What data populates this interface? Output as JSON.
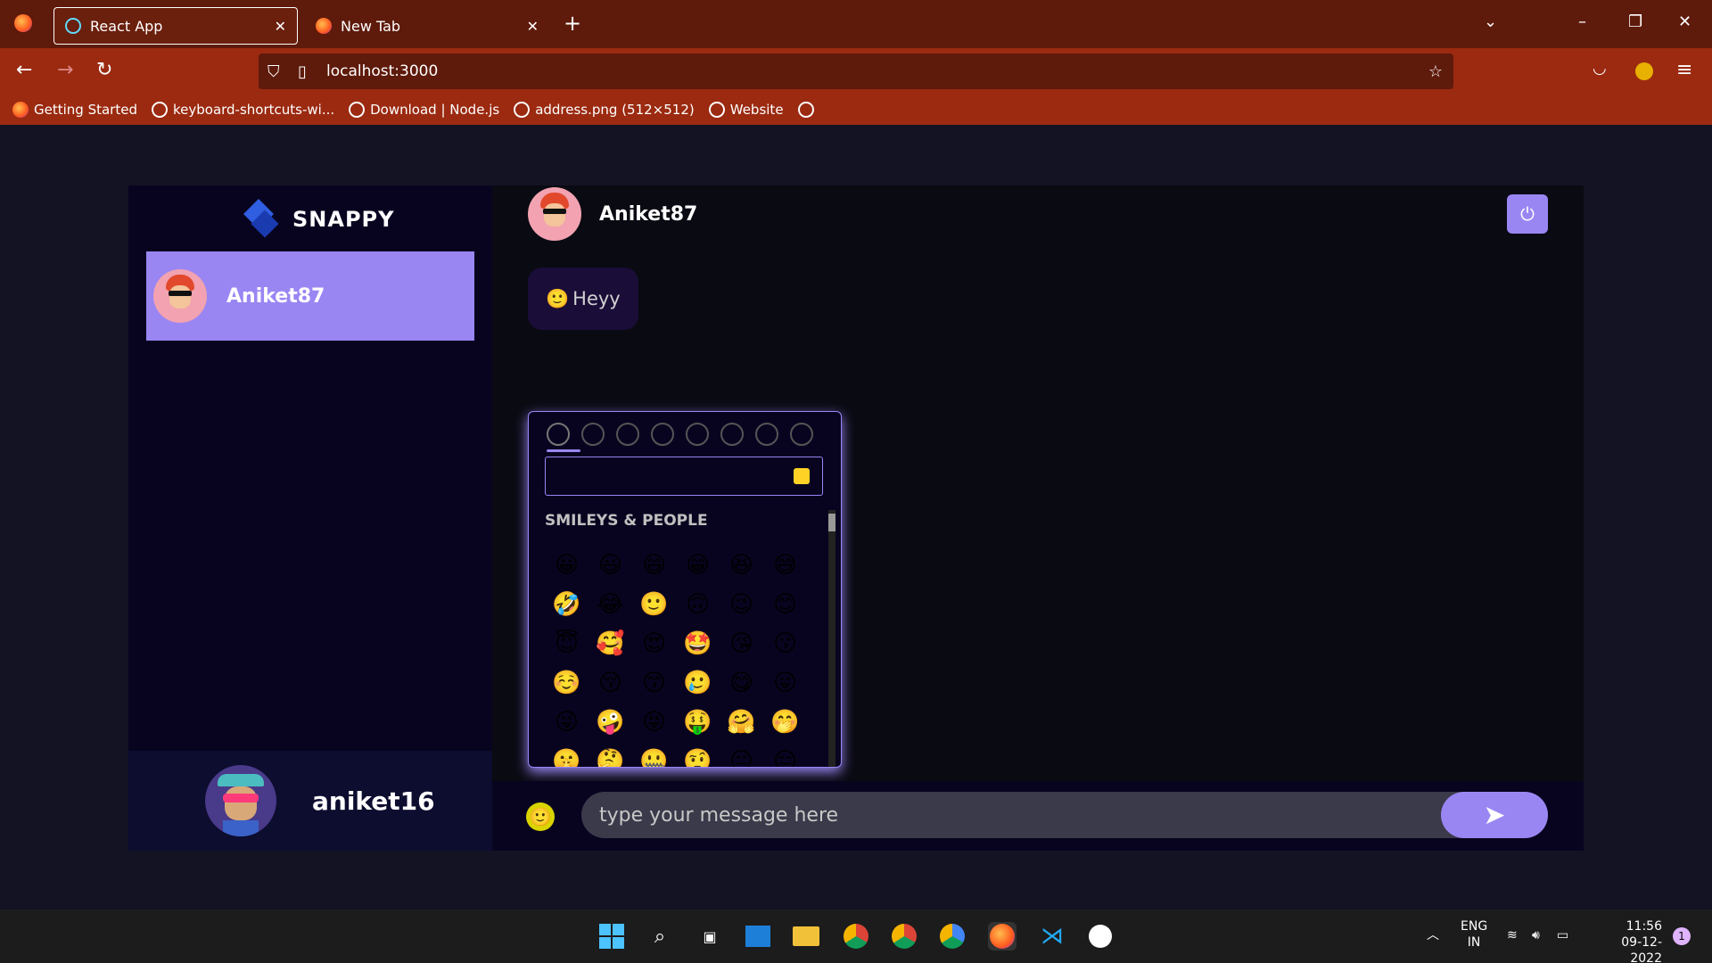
{
  "browser": {
    "tabs": [
      {
        "label": "React App",
        "active": true
      },
      {
        "label": "New Tab",
        "active": false
      }
    ],
    "url": "localhost:3000",
    "bookmarks": [
      {
        "label": "Getting Started",
        "icon": "firefox-icon"
      },
      {
        "label": "keyboard-shortcuts-wi...",
        "icon": "globe-icon"
      },
      {
        "label": "Download | Node.js",
        "icon": "globe-icon"
      },
      {
        "label": "address.png (512×512)",
        "icon": "globe-icon"
      },
      {
        "label": "Website",
        "icon": "globe-icon"
      }
    ]
  },
  "app": {
    "brand": "SNAPPY",
    "contacts": [
      {
        "name": "Aniket87",
        "selected": true
      }
    ],
    "current_user": "aniket16",
    "chat": {
      "user": "Aniket87",
      "messages": [
        {
          "emoji": "🙂",
          "text": "Heyy"
        }
      ]
    },
    "picker": {
      "section": "SMILEYS & PEOPLE",
      "emojis": [
        "😀",
        "😃",
        "😄",
        "😁",
        "😆",
        "😅",
        "🤣",
        "😂",
        "🙂",
        "🙃",
        "😉",
        "😊",
        "😇",
        "🥰",
        "😍",
        "🤩",
        "😘",
        "😗",
        "☺️",
        "😚",
        "😙",
        "🥲",
        "😋",
        "😛",
        "😜",
        "🤪",
        "😝",
        "🤑",
        "🤗",
        "🤭",
        "🤫",
        "🤔",
        "🤐",
        "🤨",
        "😐",
        "😑"
      ]
    },
    "input": {
      "placeholder": "type your message here"
    }
  },
  "taskbar": {
    "lang": "ENG",
    "region": "IN",
    "time": "11:56",
    "date": "09-12-2022",
    "notifications": "1"
  },
  "colors": {
    "accent": "#9a86f3",
    "sidebar": "#080420",
    "tab_bar": "#5e1a0b",
    "nav_bar": "#9b2a10"
  }
}
